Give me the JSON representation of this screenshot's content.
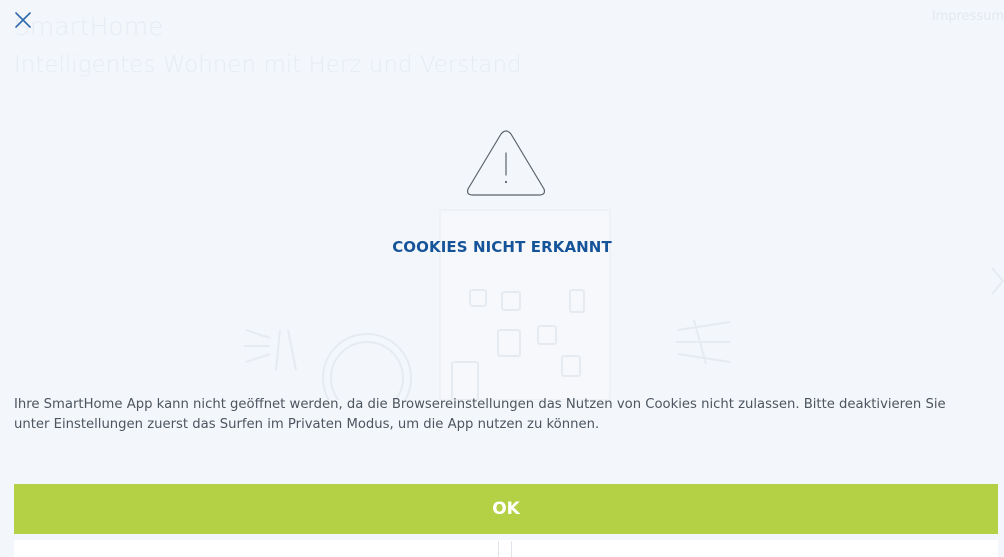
{
  "background": {
    "brand": "SmartHome",
    "tagline": "Intelligentes Wohnen mit Herz und Verstand",
    "impressum_link": "Impressum"
  },
  "dialog": {
    "close_icon": "close-icon",
    "warning_icon": "warning-triangle-icon",
    "title": "COOKIES NICHT ERKANNT",
    "message": "Ihre SmartHome App kann nicht geöffnet werden, da die Browsereinstellungen das Nutzen von Cookies nicht zulassen. Bitte deaktivieren Sie unter Einstellungen zuerst das Surfen im Privaten Modus, um die App nutzen zu können.",
    "ok_label": "OK"
  },
  "colors": {
    "accent_blue": "#16549a",
    "ok_green": "#b4d145",
    "background": "#f3f6fa",
    "text": "#4d5560"
  }
}
